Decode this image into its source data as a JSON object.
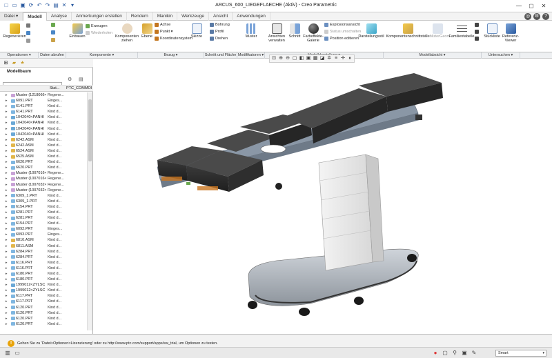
{
  "window": {
    "title": "ARCUS_600_LIEGEFLAECHE (Aktiv) - Creo Parametric"
  },
  "tabs": [
    {
      "label": "Datei ▾"
    },
    {
      "label": "Modell"
    },
    {
      "label": "Analyse"
    },
    {
      "label": "Anmerkungen erstellen"
    },
    {
      "label": "Rendern"
    },
    {
      "label": "Manikin"
    },
    {
      "label": "Werkzeuge"
    },
    {
      "label": "Ansicht"
    },
    {
      "label": "Anwendungen"
    }
  ],
  "ribbon": {
    "regenerate": "Regenerieren",
    "einbauen": "Einbauen",
    "erzeugen": "Erzeugen",
    "wiederholen": "Wiederholen",
    "komponenten": "Komponenten ziehen",
    "ebene": "Ebene",
    "achse": "Achse",
    "punkt": "Punkt ▾",
    "koord": "Koordinatensystem",
    "skizze": "Skizze",
    "bohrung": "Bohrung",
    "profil": "Profil",
    "drehen": "Drehen",
    "muster": "Muster",
    "ansichten": "Ansichten verwalten",
    "schnitt": "Schnitt",
    "farbeffekte": "Farbeffekte-Galerie",
    "explosion": "Explosionsansicht",
    "status": "Status umschalten",
    "position": "Position editieren",
    "darstellung": "Darstellungsstil",
    "komponentenschnitt": "Komponentenschnittstelle",
    "publizier": "PublizierGeom",
    "familientabelle": "Familientabelle",
    "stueckliste": "Stückliste",
    "referenz": "Referenz-Viewer"
  },
  "groups": [
    {
      "label": "Operationen ▾"
    },
    {
      "label": "Daten abrufen ▾"
    },
    {
      "label": "Komponente ▾"
    },
    {
      "label": "Bezug ▾"
    },
    {
      "label": "Schnitt und Fläche ▾"
    },
    {
      "label": "Modifikatoren ▾"
    },
    {
      "label": "Modelldarstellung ▾"
    },
    {
      "label": "Modellabsicht ▾"
    },
    {
      "label": "Untersuchen ▾"
    }
  ],
  "panel": {
    "title": "Modellbaum",
    "col_status": "Stat...",
    "col_common": "PTC_COMMOI"
  },
  "tree": [
    {
      "name": "Muster (1218066<",
      "status": "Regene..."
    },
    {
      "name": "6091.PRT",
      "status": "Einges..."
    },
    {
      "name": "6141.PRT",
      "status": "Kind d..."
    },
    {
      "name": "6141.PRT",
      "status": "Kind d..."
    },
    {
      "name": "1042040<PANHI",
      "status": "Kind d..."
    },
    {
      "name": "1042040<PANHI",
      "status": "Kind d..."
    },
    {
      "name": "1042040<PANHI",
      "status": "Kind d..."
    },
    {
      "name": "1042040<PANHI",
      "status": "Kind d..."
    },
    {
      "name": "6242.ASM",
      "status": "Kind d..."
    },
    {
      "name": "6242.ASM",
      "status": "Kind d..."
    },
    {
      "name": "6524.ASM",
      "status": "Kind d..."
    },
    {
      "name": "6525.ASM",
      "status": "Kind d..."
    },
    {
      "name": "6620.PRT",
      "status": "Kind d..."
    },
    {
      "name": "6620.PRT",
      "status": "Kind d..."
    },
    {
      "name": "Muster (1007016<",
      "status": "Regene..."
    },
    {
      "name": "Muster (1007016<",
      "status": "Regene..."
    },
    {
      "name": "Muster (1007032<",
      "status": "Regene..."
    },
    {
      "name": "Muster (1007032<",
      "status": "Regene..."
    },
    {
      "name": "6309_1.PRT",
      "status": "Kind d..."
    },
    {
      "name": "6309_1.PRT",
      "status": "Kind d..."
    },
    {
      "name": "6154.PRT",
      "status": "Kind d..."
    },
    {
      "name": "6281.PRT",
      "status": "Kind d..."
    },
    {
      "name": "6281.PRT",
      "status": "Kind d..."
    },
    {
      "name": "6154.PRT",
      "status": "Kind d..."
    },
    {
      "name": "6092.PRT",
      "status": "Einges..."
    },
    {
      "name": "6093.PRT",
      "status": "Einges..."
    },
    {
      "name": "6810.ASM",
      "status": "Kind d..."
    },
    {
      "name": "6811.ASM",
      "status": "Kind d..."
    },
    {
      "name": "6284.PRT",
      "status": "Kind d..."
    },
    {
      "name": "6284.PRT",
      "status": "Kind d..."
    },
    {
      "name": "6116.PRT",
      "status": "Kind d..."
    },
    {
      "name": "6116.PRT",
      "status": "Kind d..."
    },
    {
      "name": "6180.PRT",
      "status": "Kind d..."
    },
    {
      "name": "6180.PRT",
      "status": "Kind d..."
    },
    {
      "name": "1999012<ZYLSC",
      "status": "Kind d..."
    },
    {
      "name": "1999012<ZYLSC",
      "status": "Kind d..."
    },
    {
      "name": "6117.PRT",
      "status": "Kind d..."
    },
    {
      "name": "6117.PRT",
      "status": "Kind d..."
    },
    {
      "name": "6120.PRT",
      "status": "Kind d..."
    },
    {
      "name": "6120.PRT",
      "status": "Kind d..."
    },
    {
      "name": "6120.PRT",
      "status": "Kind d..."
    },
    {
      "name": "6120.PRT",
      "status": "Kind d..."
    }
  ],
  "status": {
    "message": "Gehen Sie zu 'Datei>Optionen>Lizenzierung' oder zu http://www.ptc.com/support/apps/sw_trial, um Optionen zu testen.",
    "selection_filter": "Smart"
  },
  "colors": {
    "accent": "#2a5aa0",
    "mattress": "#2b2b2b",
    "frame": "#8a97a6"
  }
}
